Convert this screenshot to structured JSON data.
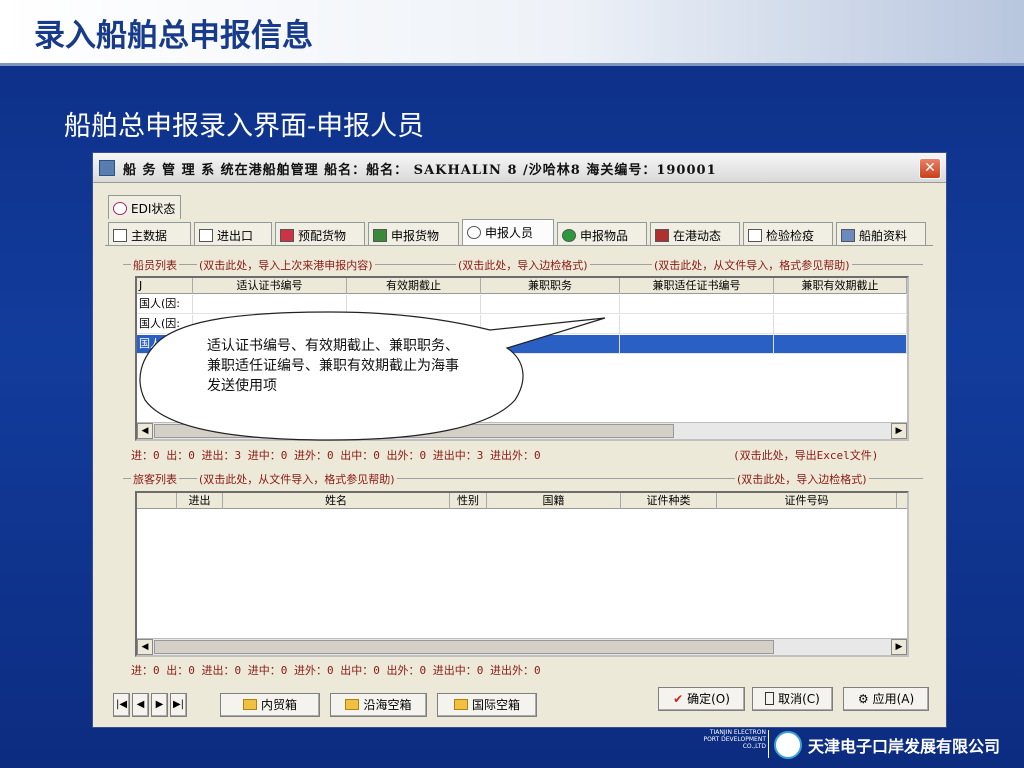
{
  "slide": {
    "title": "录入船舶总申报信息",
    "subtitle": "船舶总申报录入界面-申报人员"
  },
  "window": {
    "title": "船 务 管 理 系 统在港船舶管理  船名：船名：  SAKHALIN 8 /沙哈林8  海关编号：190001",
    "close_label": "✕"
  },
  "tabs": {
    "edi": "EDI状态",
    "items": [
      "主数据",
      "进出口",
      "预配货物",
      "申报货物",
      "申报人员",
      "申报物品",
      "在港动态",
      "检验检疫",
      "船舶资料"
    ],
    "active": "申报人员"
  },
  "crew": {
    "group_label": "船员列表",
    "link1": "(双击此处，导入上次来港申报内容)",
    "link2": "(双击此处，导入边检格式)",
    "link3": "(双击此处，从文件导入，格式参见帮助)",
    "columns": [
      "J",
      "适认证书编号",
      "有效期截止",
      "兼职职务",
      "兼职适任证书编号",
      "兼职有效期截止"
    ],
    "rows": [
      [
        "国人(因:",
        "",
        "",
        "",
        "",
        ""
      ],
      [
        "国人(因:",
        "",
        "",
        "",
        "",
        ""
      ],
      [
        "国人",
        "",
        "",
        "",
        "",
        ""
      ]
    ],
    "status": "进：0 出：0 进出：3 进中：0 进外：0 出中：0 出外：0 进出中：3 进出外：0",
    "export_link": "(双击此处，导出Excel文件)"
  },
  "passengers": {
    "group_label": "旅客列表",
    "link1": "(双击此处，从文件导入，格式参见帮助)",
    "link2": "(双击此处，导入边检格式)",
    "columns": [
      "进出",
      "姓名",
      "性别",
      "国籍",
      "证件种类",
      "证件号码"
    ],
    "status": "进：0 出：0 进出：0 进中：0 进外：0 出中：0 出外：0 进出中：0 进出外：0"
  },
  "buttons": {
    "nav": [
      "|◀",
      "◀",
      "▶",
      "▶|"
    ],
    "domestic": "内贸箱",
    "coastal": "沿海空箱",
    "international": "国际空箱",
    "ok": "确定(O)",
    "cancel": "取消(C)",
    "apply": "应用(A)"
  },
  "callout": {
    "text": "适认证书编号、有效期截止、兼职职务、兼职适任证编号、兼职有效期截止为海事发送使用项"
  },
  "footer": {
    "logo_en": "TIANJIN ELECTRON PORT DEVELOPMENT CO.,LTD",
    "logo_cn": "天津电子口岸发展有限公司"
  },
  "colors": {
    "background": "#123c9c",
    "window": "#ece9d8",
    "selection": "#2a5fc4",
    "link_text": "#8a1a14"
  }
}
